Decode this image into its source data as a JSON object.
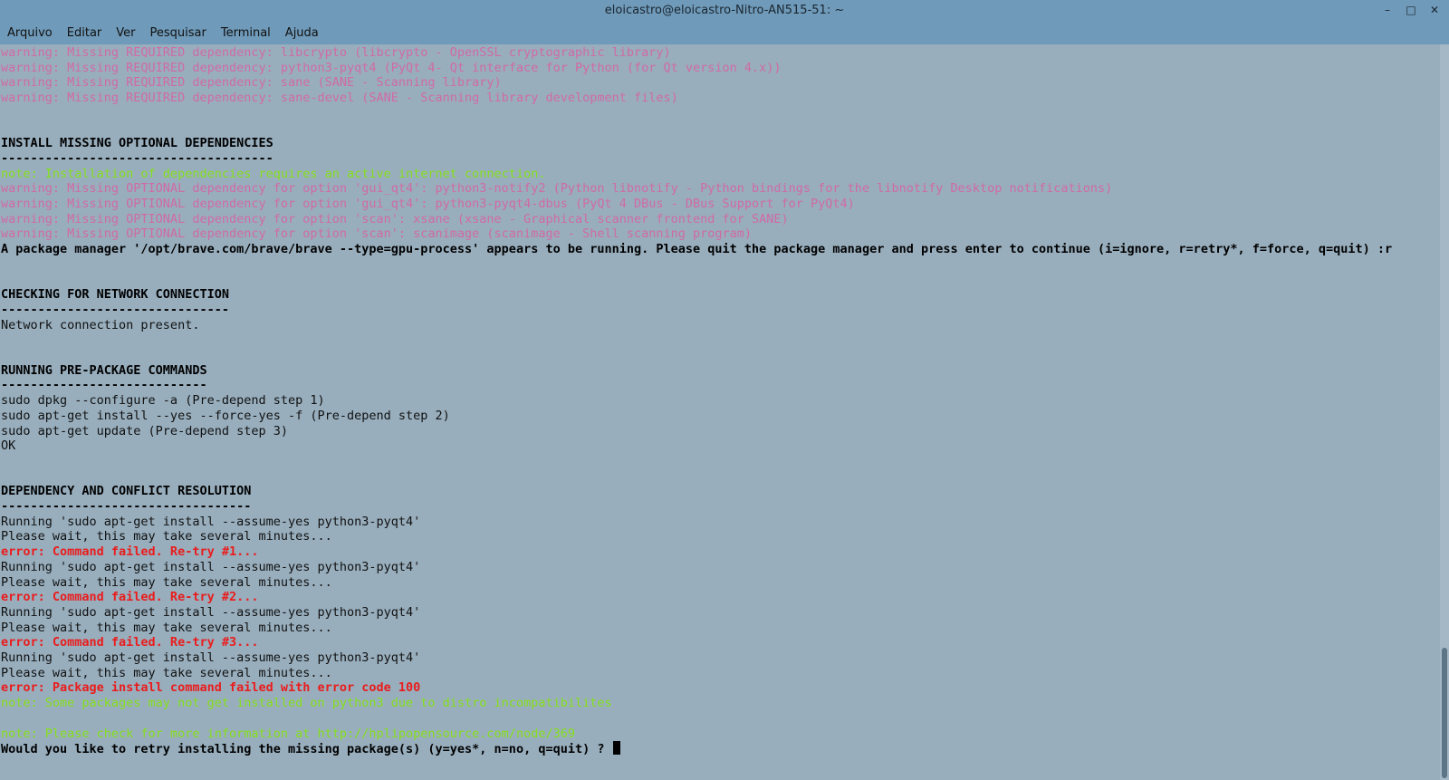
{
  "window": {
    "title": "eloicastro@eloicastro-Nitro-AN515-51: ~",
    "minimize": "–",
    "maximize": "□",
    "close": "✕"
  },
  "menu": {
    "items": [
      "Arquivo",
      "Editar",
      "Ver",
      "Pesquisar",
      "Terminal",
      "Ajuda"
    ]
  },
  "terminal": {
    "lines": [
      {
        "text": "warning: Missing REQUIRED dependency: libcrypto (libcrypto - OpenSSL cryptographic library)",
        "style": "warn"
      },
      {
        "text": "warning: Missing REQUIRED dependency: python3-pyqt4 (PyQt 4- Qt interface for Python (for Qt version 4.x))",
        "style": "warn"
      },
      {
        "text": "warning: Missing REQUIRED dependency: sane (SANE - Scanning library)",
        "style": "warn"
      },
      {
        "text": "warning: Missing REQUIRED dependency: sane-devel (SANE - Scanning library development files)",
        "style": "warn"
      },
      {
        "text": "",
        "style": "normal"
      },
      {
        "text": "",
        "style": "normal"
      },
      {
        "text": "INSTALL MISSING OPTIONAL DEPENDENCIES",
        "style": "bold"
      },
      {
        "text": "-------------------------------------",
        "style": "bold"
      },
      {
        "text": "note: Installation of dependencies requires an active internet connection.",
        "style": "note"
      },
      {
        "text": "warning: Missing OPTIONAL dependency for option 'gui_qt4': python3-notify2 (Python libnotify - Python bindings for the libnotify Desktop notifications)",
        "style": "warn"
      },
      {
        "text": "warning: Missing OPTIONAL dependency for option 'gui_qt4': python3-pyqt4-dbus (PyQt 4 DBus - DBus Support for PyQt4)",
        "style": "warn"
      },
      {
        "text": "warning: Missing OPTIONAL dependency for option 'scan': xsane (xsane - Graphical scanner frontend for SANE)",
        "style": "warn"
      },
      {
        "text": "warning: Missing OPTIONAL dependency for option 'scan': scanimage (scanimage - Shell scanning program)",
        "style": "warn"
      },
      {
        "text": "A package manager '/opt/brave.com/brave/brave --type=gpu-process' appears to be running. Please quit the package manager and press enter to continue (i=ignore, r=retry*, f=force, q=quit) :r",
        "style": "bold"
      },
      {
        "text": "",
        "style": "normal"
      },
      {
        "text": "",
        "style": "normal"
      },
      {
        "text": "CHECKING FOR NETWORK CONNECTION",
        "style": "bold"
      },
      {
        "text": "-------------------------------",
        "style": "bold"
      },
      {
        "text": "Network connection present.",
        "style": "normal"
      },
      {
        "text": "",
        "style": "normal"
      },
      {
        "text": "",
        "style": "normal"
      },
      {
        "text": "RUNNING PRE-PACKAGE COMMANDS",
        "style": "bold"
      },
      {
        "text": "----------------------------",
        "style": "bold"
      },
      {
        "text": "sudo dpkg --configure -a (Pre-depend step 1)",
        "style": "normal"
      },
      {
        "text": "sudo apt-get install --yes --force-yes -f (Pre-depend step 2)",
        "style": "normal"
      },
      {
        "text": "sudo apt-get update (Pre-depend step 3)",
        "style": "normal"
      },
      {
        "text": "OK",
        "style": "normal"
      },
      {
        "text": "",
        "style": "normal"
      },
      {
        "text": "",
        "style": "normal"
      },
      {
        "text": "DEPENDENCY AND CONFLICT RESOLUTION",
        "style": "bold"
      },
      {
        "text": "----------------------------------",
        "style": "bold"
      },
      {
        "text": "Running 'sudo apt-get install --assume-yes python3-pyqt4'",
        "style": "normal"
      },
      {
        "text": "Please wait, this may take several minutes...",
        "style": "normal"
      },
      {
        "text": "error: Command failed. Re-try #1...",
        "style": "err"
      },
      {
        "text": "Running 'sudo apt-get install --assume-yes python3-pyqt4'",
        "style": "normal"
      },
      {
        "text": "Please wait, this may take several minutes...",
        "style": "normal"
      },
      {
        "text": "error: Command failed. Re-try #2...",
        "style": "err"
      },
      {
        "text": "Running 'sudo apt-get install --assume-yes python3-pyqt4'",
        "style": "normal"
      },
      {
        "text": "Please wait, this may take several minutes...",
        "style": "normal"
      },
      {
        "text": "error: Command failed. Re-try #3...",
        "style": "err"
      },
      {
        "text": "Running 'sudo apt-get install --assume-yes python3-pyqt4'",
        "style": "normal"
      },
      {
        "text": "Please wait, this may take several minutes...",
        "style": "normal"
      },
      {
        "text": "error: Package install command failed with error code 100",
        "style": "err"
      },
      {
        "text": "note: Some packages may not get installed on python3 due to distro incompatibilites",
        "style": "note"
      },
      {
        "text": "",
        "style": "normal"
      },
      {
        "text": "note: Please check for more information at http://hplipopensource.com/node/369",
        "style": "note"
      },
      {
        "text": "Would you like to retry installing the missing package(s) (y=yes*, n=no, q=quit) ? ",
        "style": "bold",
        "cursor": true
      }
    ]
  }
}
